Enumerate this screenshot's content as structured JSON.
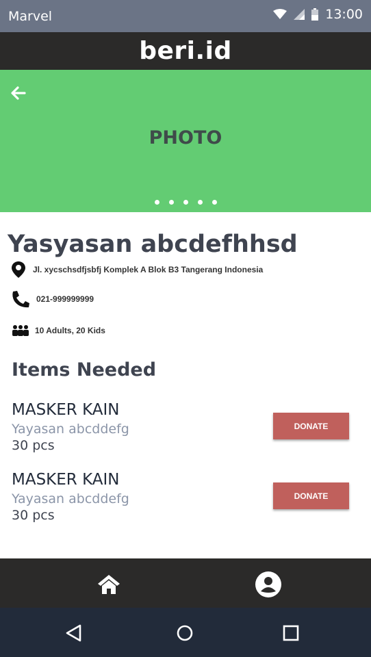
{
  "status_bar": {
    "carrier": "Marvel",
    "time": "13:00",
    "icons": [
      "wifi-icon",
      "cell-signal-icon",
      "battery-icon"
    ]
  },
  "app_bar": {
    "brand": "beri.id"
  },
  "hero": {
    "placeholder": "PHOTO",
    "back_icon": "arrow-left-icon",
    "page_count": 5
  },
  "organization": {
    "name": "Yasyasan abcdefhhsd",
    "address": "Jl. xycschsdfjsbfj Komplek A Blok B3 Tangerang Indonesia",
    "phone": "021-999999999",
    "residents": "10 Adults, 20 Kids"
  },
  "items_section": {
    "title": "Items Needed",
    "items": [
      {
        "name": "MASKER KAIN",
        "organization": "Yayasan abcddefg",
        "quantity": "30 pcs",
        "action": "DONATE"
      },
      {
        "name": "MASKER KAIN",
        "organization": "Yayasan abcddefg",
        "quantity": "30 pcs",
        "action": "DONATE"
      }
    ]
  },
  "bottom_nav": {
    "items": [
      "home-icon",
      "profile-icon"
    ]
  },
  "system_nav": {
    "items": [
      "back-triangle-icon",
      "home-circle-icon",
      "recents-square-icon"
    ]
  },
  "colors": {
    "status_bar": "#6b7486",
    "app_bar": "#2b2a29",
    "hero": "#63cc73",
    "donate_button": "#c0605c",
    "system_nav": "#222b3a"
  }
}
